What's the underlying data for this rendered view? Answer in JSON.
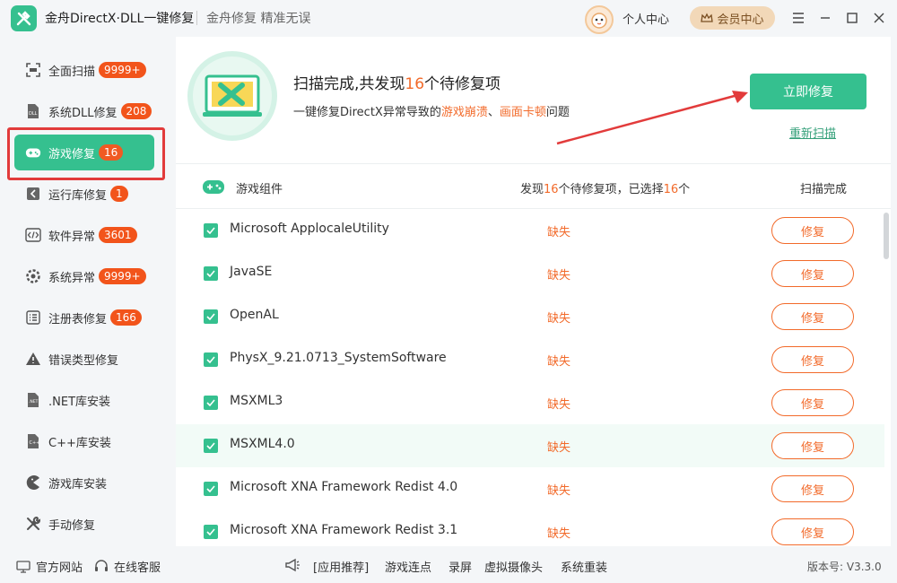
{
  "app": {
    "title": "金舟DirectX·DLL一键修复",
    "slogan": "金舟修复 精准无误",
    "user_center": "个人中心",
    "vip_label": "会员中心"
  },
  "sidebar": {
    "items": [
      {
        "label": "全面扫描",
        "badge": "9999+",
        "icon": "scan-icon"
      },
      {
        "label": "系统DLL修复",
        "badge": "208",
        "icon": "dll-icon"
      },
      {
        "label": "游戏修复",
        "badge": "16",
        "icon": "gamepad-icon",
        "active": true
      },
      {
        "label": "运行库修复",
        "badge": "1",
        "icon": "runtime-icon"
      },
      {
        "label": "软件异常",
        "badge": "3601",
        "icon": "code-icon"
      },
      {
        "label": "系统异常",
        "badge": "9999+",
        "icon": "gear-icon"
      },
      {
        "label": "注册表修复",
        "badge": "166",
        "icon": "list-icon"
      },
      {
        "label": "错误类型修复",
        "badge": "",
        "icon": "warning-icon"
      },
      {
        "label": ".NET库安装",
        "badge": "",
        "icon": "net-icon"
      },
      {
        "label": "C++库安装",
        "badge": "",
        "icon": "cpp-icon"
      },
      {
        "label": "游戏库安装",
        "badge": "",
        "icon": "pacman-icon"
      },
      {
        "label": "手动修复",
        "badge": "",
        "icon": "wrench-icon"
      }
    ]
  },
  "hero": {
    "title_prefix": "扫描完成,共发现",
    "title_count": "16",
    "title_suffix": "个待修复项",
    "sub_prefix": "一键修复DirectX异常导致的",
    "sub_warn1": "游戏崩溃",
    "sub_sep": "、",
    "sub_warn2": "画面卡顿",
    "sub_suffix": "问题",
    "fix_now": "立即修复",
    "rescan": "重新扫描"
  },
  "list": {
    "header_title": "游戏组件",
    "found_prefix": "发现",
    "found_count": "16",
    "found_mid": "个待修复项，已选择",
    "selected_count": "16",
    "found_suffix": "个",
    "status_done": "扫描完成",
    "rows": [
      {
        "name": "Microsoft ApplocaleUtility",
        "status": "缺失",
        "action": "修复"
      },
      {
        "name": "JavaSE",
        "status": "缺失",
        "action": "修复"
      },
      {
        "name": "OpenAL",
        "status": "缺失",
        "action": "修复"
      },
      {
        "name": "PhysX_9.21.0713_SystemSoftware",
        "status": "缺失",
        "action": "修复"
      },
      {
        "name": "MSXML3",
        "status": "缺失",
        "action": "修复"
      },
      {
        "name": "MSXML4.0",
        "status": "缺失",
        "action": "修复"
      },
      {
        "name": "Microsoft XNA Framework Redist 4.0",
        "status": "缺失",
        "action": "修复"
      },
      {
        "name": "Microsoft XNA Framework Redist 3.1",
        "status": "缺失",
        "action": "修复"
      }
    ]
  },
  "footer": {
    "official_site": "官方网站",
    "online_service": "在线客服",
    "recommend": "[应用推荐]",
    "links": [
      "游戏连点",
      "录屏",
      "虚拟摄像头",
      "系统重装"
    ],
    "version": "版本号: V3.3.0"
  },
  "colors": {
    "accent": "#35c08f",
    "warning": "#f26a2a",
    "badge": "#f2541b",
    "highlight": "#e23b3b"
  }
}
